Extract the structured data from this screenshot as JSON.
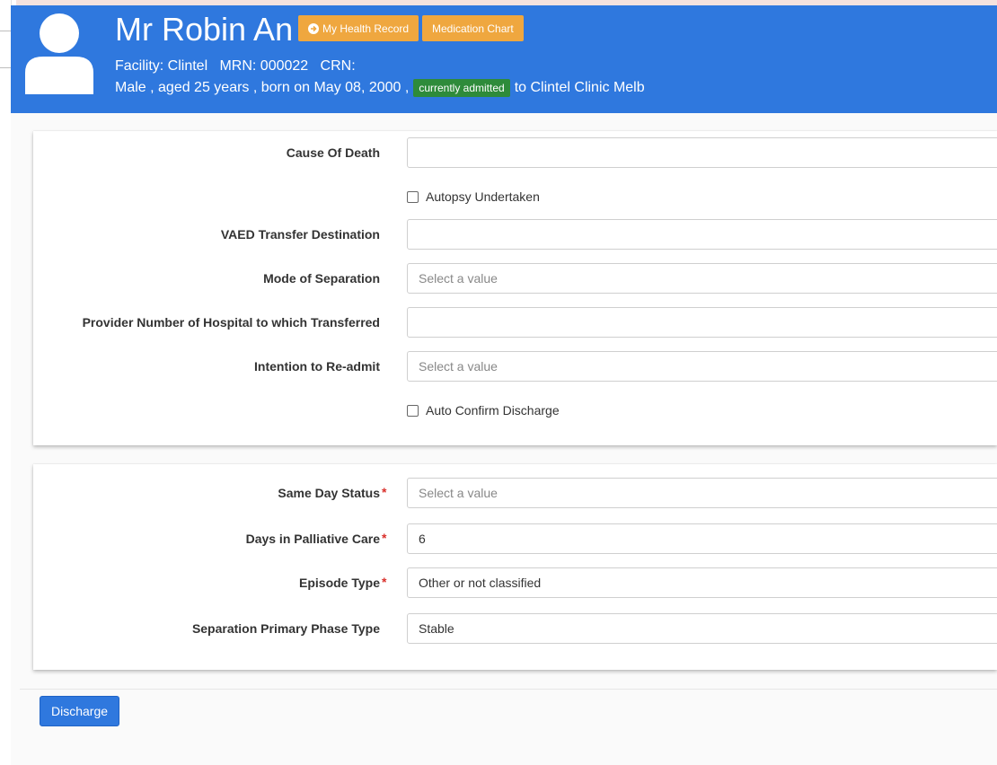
{
  "patient": {
    "name": "Mr Robin An",
    "facility_line": "Facility: Clintel   MRN: 000022   CRN:",
    "demo_line": "Male , aged 25 years , born on May 08, 2000 ,",
    "status_badge": "currently admitted",
    "location_text": "to Clintel Clinic Melb"
  },
  "header_buttons": {
    "my_health_record": "My Health Record",
    "medication_chart": "Medication Chart"
  },
  "section1": {
    "cause_of_death": {
      "label": "Cause Of Death",
      "value": ""
    },
    "autopsy": {
      "label": "Autopsy Undertaken",
      "checked": false
    },
    "vaed_transfer": {
      "label": "VAED Transfer Destination",
      "value": ""
    },
    "mode_of_separation": {
      "label": "Mode of Separation",
      "placeholder": "Select a value"
    },
    "provider_number": {
      "label": "Provider Number of Hospital to which Transferred",
      "value": ""
    },
    "intention_readmit": {
      "label": "Intention to Re-admit",
      "placeholder": "Select a value"
    },
    "auto_confirm": {
      "label": "Auto Confirm Discharge",
      "checked": false
    }
  },
  "section2": {
    "same_day_status": {
      "label": "Same Day Status",
      "placeholder": "Select a value"
    },
    "days_palliative": {
      "label": "Days in Palliative Care",
      "value": "6"
    },
    "episode_type": {
      "label": "Episode Type",
      "value": "Other or not classified"
    },
    "separation_phase": {
      "label": "Separation Primary Phase Type",
      "value": "Stable"
    }
  },
  "required_marker": "*",
  "actions": {
    "discharge": "Discharge"
  },
  "colors": {
    "header": "#2f78de",
    "button_orange": "#efa73f",
    "badge_green": "#2e8b3a",
    "required": "#d9302b"
  }
}
